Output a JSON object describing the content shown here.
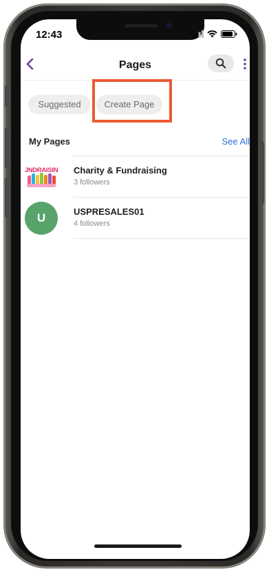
{
  "status_bar": {
    "time": "12:43"
  },
  "header": {
    "title": "Pages",
    "back_icon": "chevron-left-icon",
    "search_icon": "search-icon",
    "more_icon": "more-vertical-icon"
  },
  "chips": [
    {
      "label": "Suggested"
    },
    {
      "label": "Create Page"
    }
  ],
  "my_pages": {
    "title": "My Pages",
    "see_all_label": "See All",
    "items": [
      {
        "name": "Charity & Fundraising",
        "followers": "3 followers",
        "avatar_text": "JNDRAISIN"
      },
      {
        "name": "USPRESALES01",
        "followers": "4 followers",
        "avatar_letter": "U"
      }
    ]
  },
  "colors": {
    "accent_purple": "#6b3fa0",
    "link_blue": "#2b6fd6",
    "highlight_orange": "#ea5a33",
    "avatar_green": "#58a36a"
  }
}
